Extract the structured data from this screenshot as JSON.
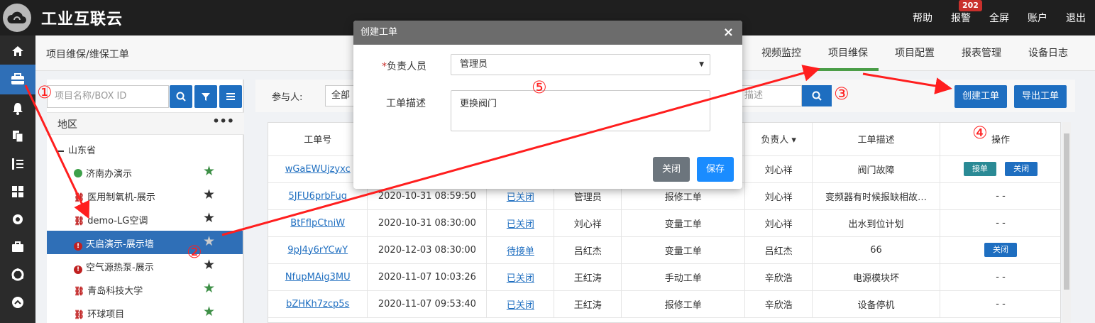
{
  "header": {
    "title": "工业互联云",
    "nav": [
      "帮助",
      "报警",
      "全屏",
      "账户",
      "退出"
    ],
    "alarm_badge": "202"
  },
  "sidebar": {
    "icons": [
      "home-icon",
      "maintenance-icon",
      "bell-icon",
      "copy-icon",
      "list-tools-icon",
      "grid-icon",
      "settings-icon",
      "briefcase-icon",
      "network-icon",
      "chevron-circle-icon"
    ]
  },
  "breadcrumb": "项目维保/维保工单",
  "tabs": [
    "视频监控",
    "项目维保",
    "项目配置",
    "报表管理",
    "设备日志"
  ],
  "left_panel": {
    "search_placeholder": "项目名称/BOX ID",
    "region_label": "地区",
    "more": "•••",
    "province": "山东省",
    "items": [
      {
        "label": "济南办演示",
        "status": "online",
        "star_color": "#3d8f46"
      },
      {
        "label": "医用制氧机-展示",
        "status": "offline",
        "star_color": "#333333"
      },
      {
        "label": "demo-LG空调",
        "status": "offline",
        "star_color": "#333333"
      },
      {
        "label": "天启演示-展示墙",
        "status": "alarm",
        "star_color": "#cccccc"
      },
      {
        "label": "空气源热泵-展示",
        "status": "alarm",
        "star_color": "#333333"
      },
      {
        "label": "青岛科技大学",
        "status": "offline",
        "star_color": "#3d8f46"
      },
      {
        "label": "环球项目",
        "status": "offline",
        "star_color": "#3d8f46"
      }
    ]
  },
  "filter": {
    "participant_label": "参与人:",
    "participant_value": "全部",
    "desc_placeholder": "描述",
    "create_button": "创建工单",
    "export_button": "导出工单"
  },
  "table": {
    "headers": [
      "工单号",
      "",
      "",
      "",
      "",
      "负责人 ▾",
      "工单描述",
      "操作"
    ],
    "rows": [
      {
        "id": "wGaEWUjzyxc",
        "time": "",
        "status": "",
        "creator": "",
        "type": "",
        "owner": "刘心祥",
        "desc": "阀门故障",
        "ops": [
          "接单",
          "关闭"
        ]
      },
      {
        "id": "5JFU6prbFug",
        "time": "2020-10-31 08:59:50",
        "status": "已关闭",
        "creator": "管理员",
        "type": "报修工单",
        "owner": "刘心祥",
        "desc": "变频器有时候报缺相故…",
        "ops": "- -"
      },
      {
        "id": "BtFflpCtniW",
        "time": "2020-10-31 08:30:00",
        "status": "已关闭",
        "creator": "刘心祥",
        "type": "变量工单",
        "owner": "刘心祥",
        "desc": "出水到位计划",
        "ops": "- -"
      },
      {
        "id": "9pJ4y6rYCwY",
        "time": "2020-12-03 08:30:00",
        "status": "待接单",
        "creator": "吕红杰",
        "type": "变量工单",
        "owner": "吕红杰",
        "desc": "66",
        "ops": [
          "关闭"
        ]
      },
      {
        "id": "NfupMAig3MU",
        "time": "2020-11-07 10:03:26",
        "status": "已关闭",
        "creator": "王红涛",
        "type": "手动工单",
        "owner": "辛欣浩",
        "desc": "电源模块坏",
        "ops": "- -"
      },
      {
        "id": "bZHKh7zcp5s",
        "time": "2020-11-07 09:53:40",
        "status": "已关闭",
        "creator": "王红涛",
        "type": "报修工单",
        "owner": "辛欣浩",
        "desc": "设备停机",
        "ops": "- -"
      }
    ]
  },
  "modal": {
    "title": "创建工单",
    "close": "×",
    "owner_label_req": "*",
    "owner_label": "负责人员",
    "owner_value": "管理员",
    "desc_label": "工单描述",
    "desc_value": "更换阀门",
    "close_button": "关闭",
    "save_button": "保存"
  },
  "annotations": [
    "①",
    "②",
    "③",
    "④",
    "⑤"
  ],
  "colors": {
    "primary": "#1e6ec0",
    "teal": "#2a8a95",
    "tab_active": "#4a9d47",
    "annotation": "#ff1e1e"
  }
}
